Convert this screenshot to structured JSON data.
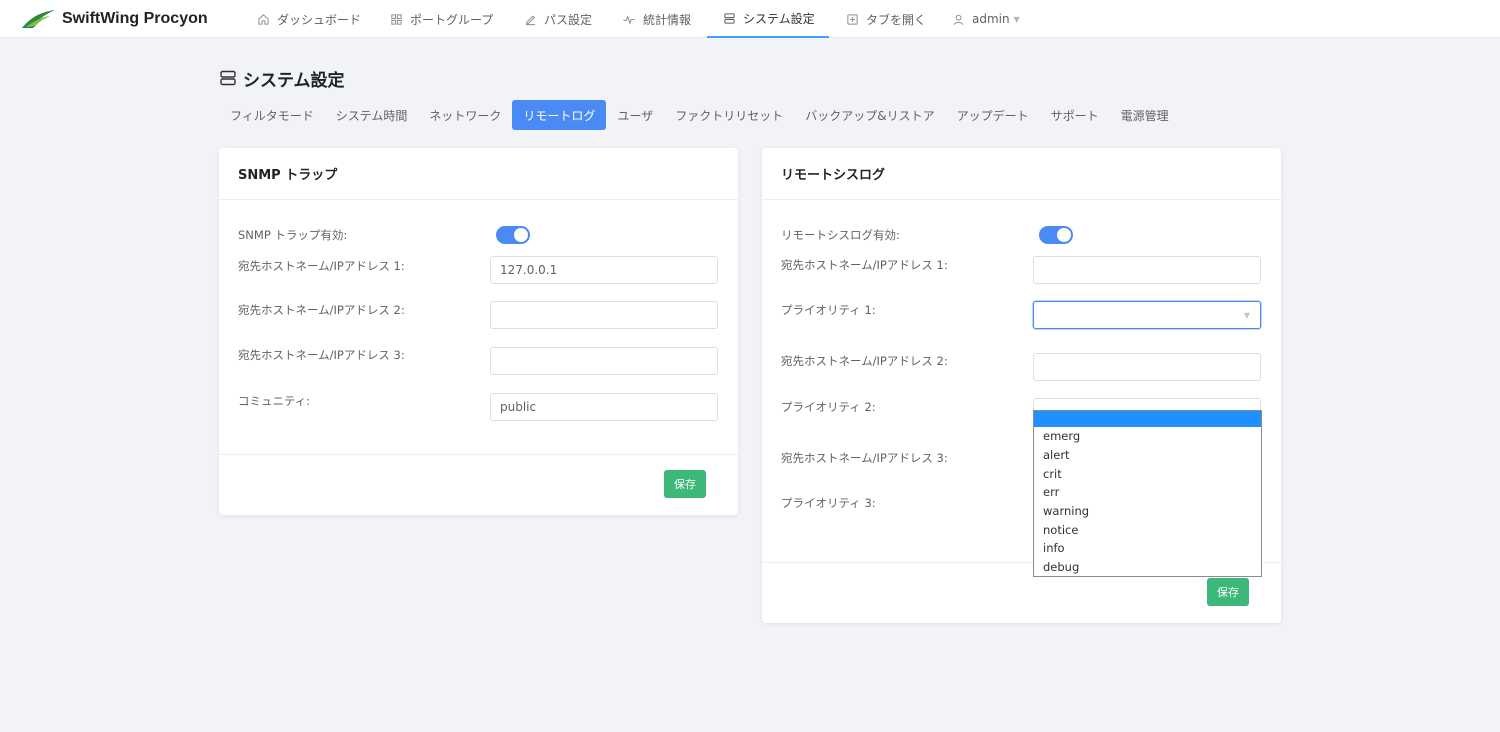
{
  "brand": {
    "name": "SwiftWing Procyon",
    "logo_color": "#2e8b3a"
  },
  "nav": {
    "items": [
      {
        "label": "ダッシュボード",
        "icon": "home-icon"
      },
      {
        "label": "ポートグループ",
        "icon": "grid-icon"
      },
      {
        "label": "パス設定",
        "icon": "edit-icon"
      },
      {
        "label": "統計情報",
        "icon": "pulse-icon"
      },
      {
        "label": "システム設定",
        "icon": "server-icon",
        "active": true
      },
      {
        "label": "タブを開く",
        "icon": "plus-square-icon"
      },
      {
        "label": "admin",
        "icon": "user-icon"
      }
    ]
  },
  "page": {
    "title": "システム設定"
  },
  "subtabs": [
    "フィルタモード",
    "システム時間",
    "ネットワーク",
    "リモートログ",
    "ユーザ",
    "ファクトリリセット",
    "バックアップ&リストア",
    "アップデート",
    "サポート",
    "電源管理"
  ],
  "active_subtab": "リモートログ",
  "snmp": {
    "title": "SNMP トラップ",
    "enabled_label": "SNMP トラップ有効:",
    "enabled": true,
    "host1_label": "宛先ホストネーム/IPアドレス 1:",
    "host1_value": "127.0.0.1",
    "host2_label": "宛先ホストネーム/IPアドレス 2:",
    "host2_value": "",
    "host3_label": "宛先ホストネーム/IPアドレス 3:",
    "host3_value": "",
    "community_label": "コミュニティ:",
    "community_value": "public",
    "save_label": "保存"
  },
  "syslog": {
    "title": "リモートシスログ",
    "enabled_label": "リモートシスログ有効:",
    "enabled": true,
    "host1_label": "宛先ホストネーム/IPアドレス 1:",
    "host1_value": "",
    "priority1_label": "プライオリティ 1:",
    "priority1_value": "",
    "host2_label": "宛先ホストネーム/IPアドレス 2:",
    "host2_value": "",
    "priority2_label": "プライオリティ 2:",
    "host3_label": "宛先ホストネーム/IPアドレス 3:",
    "priority3_label": "プライオリティ 3:",
    "save_label": "保存"
  },
  "priority_options": [
    "",
    "emerg",
    "alert",
    "crit",
    "err",
    "warning",
    "notice",
    "info",
    "debug"
  ],
  "colors": {
    "accent": "#4a8af4",
    "save": "#3cb878",
    "dropdown_highlight": "#1e90ff"
  }
}
